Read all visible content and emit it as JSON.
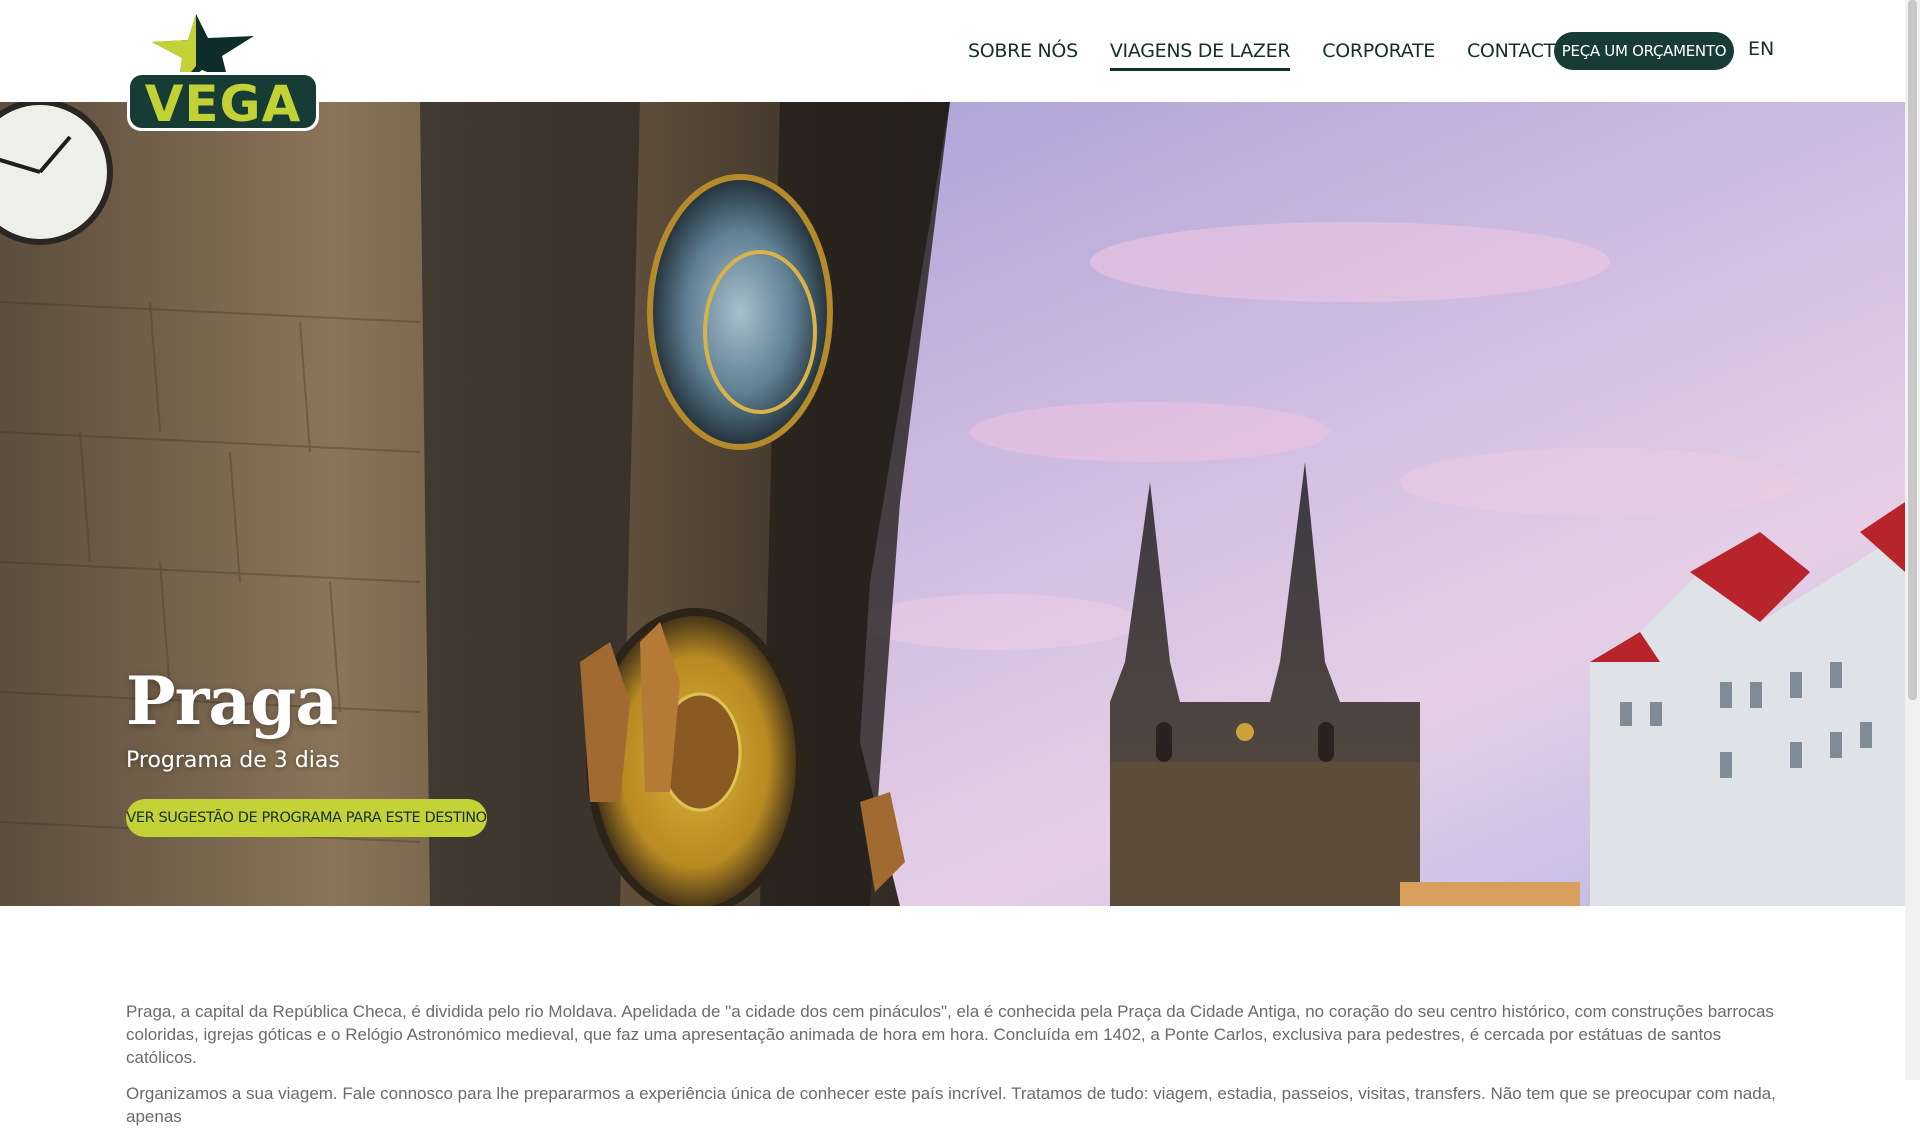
{
  "brand": {
    "name": "VEGA",
    "colors": {
      "dark_green": "#173b35",
      "lime": "#c4d237",
      "text": "#14302c"
    }
  },
  "nav": {
    "items": [
      {
        "label": "SOBRE NÓS",
        "active": false
      },
      {
        "label": "VIAGENS DE LAZER",
        "active": true
      },
      {
        "label": "CORPORATE",
        "active": false
      },
      {
        "label": "CONTACTE-NOS",
        "active": false
      }
    ],
    "cta_label": "PEÇA UM ORÇAMENTO",
    "language": "EN"
  },
  "hero": {
    "title": "Praga",
    "subtitle": "Programa de 3 dias",
    "button_label": "VER SUGESTÃO DE PROGRAMA PARA ESTE DESTINO"
  },
  "content": {
    "paragraphs": [
      "Praga, a capital da República Checa, é dividida pelo rio Moldava. Apelidada de \"a cidade dos cem pináculos\", ela é conhecida pela Praça da Cidade Antiga, no coração do seu centro histórico, com construções barrocas coloridas, igrejas góticas e o Relógio Astronómico medieval, que faz uma apresentação animada de hora em hora. Concluída em 1402, a Ponte Carlos, exclusiva para pedestres, é cercada por estátuas de santos católicos.",
      "Organizamos a sua viagem. Fale connosco para lhe prepararmos a experiência única de conhecer este país incrível. Tratamos de tudo: viagem, estadia, passeios, visitas, transfers. Não tem que se preocupar com nada, apenas"
    ]
  }
}
